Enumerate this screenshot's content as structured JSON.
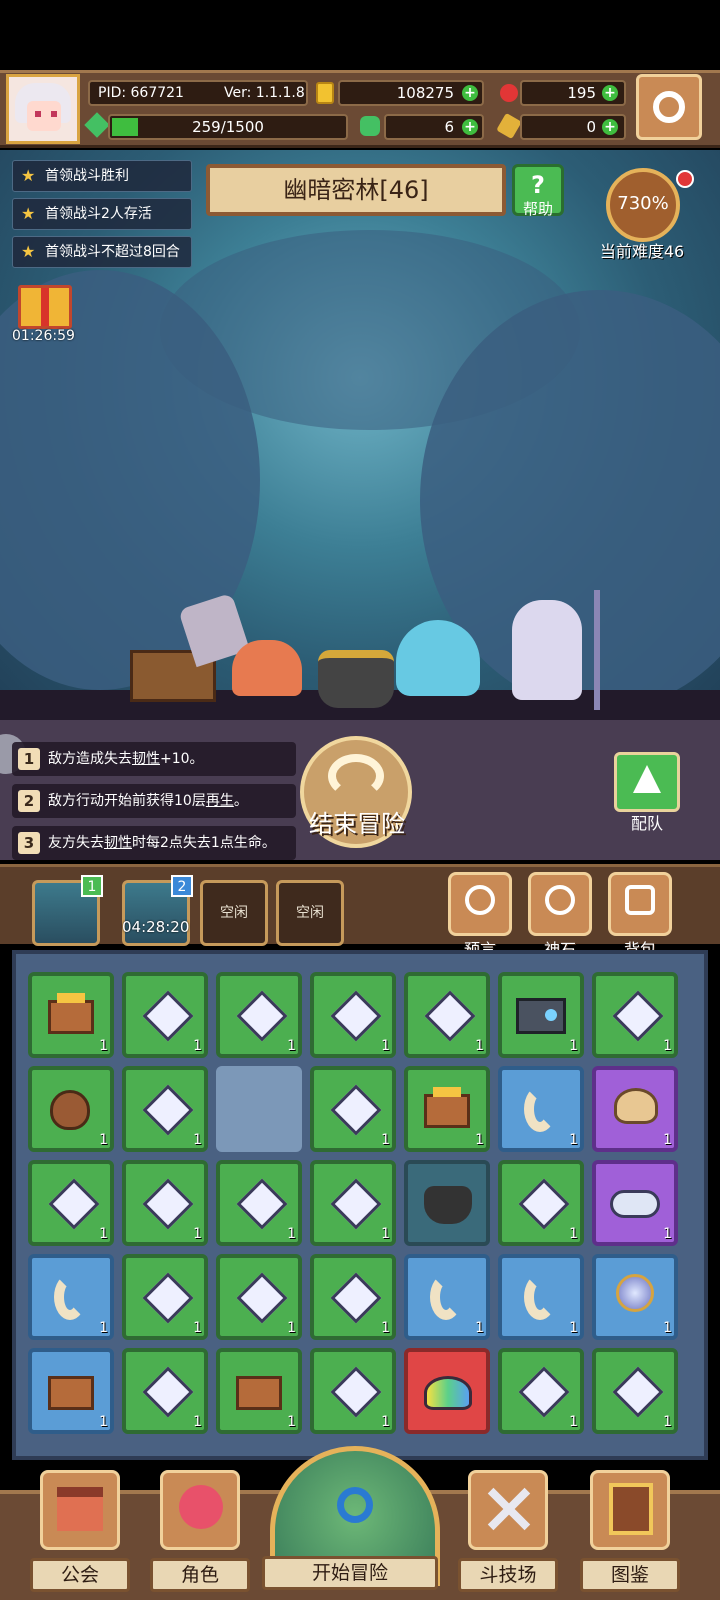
{
  "status": {
    "pid": "PID: 667721",
    "version": "Ver: 1.1.1.8",
    "gold": "108275",
    "gems": "195",
    "stamina": "259/1500",
    "clover": "6",
    "keys": "0"
  },
  "stage": {
    "title": "幽暗密林[46]",
    "help": "帮助",
    "difficulty_percent": "730%",
    "difficulty_label": "当前难度46",
    "gift_timer": "01:26:59"
  },
  "quests": [
    "首领战斗胜利",
    "首领战斗2人存活",
    "首领战斗不超过8回合"
  ],
  "battle_rules": [
    {
      "num": "1",
      "pre": "敌方造成失去",
      "key": "韧性",
      "post": "+10。"
    },
    {
      "num": "2",
      "pre": "敌方行动开始前获得10层",
      "key": "再生",
      "post": "。"
    },
    {
      "num": "3",
      "pre": "友方失去",
      "key": "韧性",
      "post": "时每2点失去1点生命。"
    }
  ],
  "end_adventure": "结束冒险",
  "team": "配队",
  "slots": {
    "slot1_badge": "1",
    "slot2_badge": "2",
    "slot2_timer": "04:28:20",
    "slot3": "空闲",
    "slot4": "空闲"
  },
  "side_buttons": {
    "prophecy": "预言",
    "god_stone": "神石",
    "backpack": "背包"
  },
  "inventory_count": "1",
  "nav": {
    "guild": "公会",
    "character": "角色",
    "start": "开始冒险",
    "arena": "斗技场",
    "codex": "图鉴"
  },
  "colors": {
    "green": "#4caf50",
    "blue": "#5b9dd6",
    "purple": "#a060d8",
    "red": "#e04646",
    "frame": "#6b4a34"
  }
}
